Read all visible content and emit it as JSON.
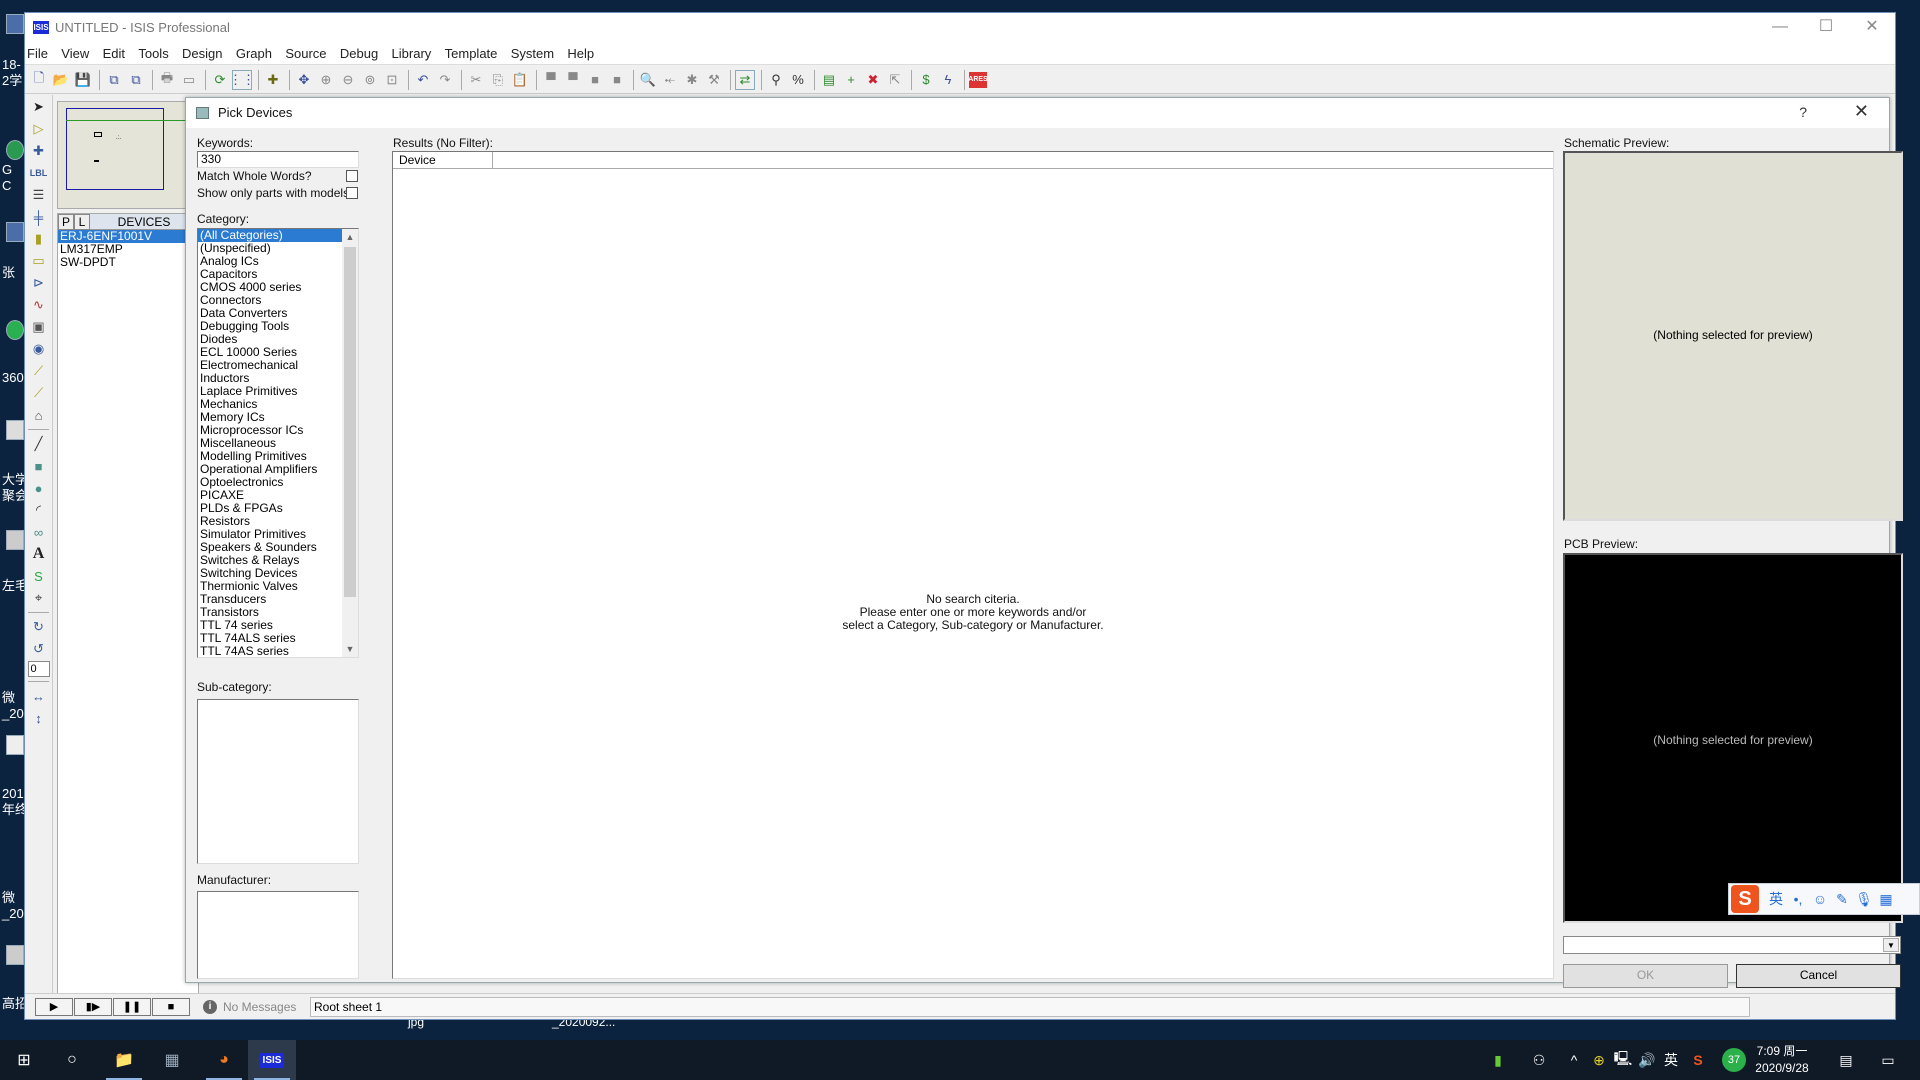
{
  "desktop": {
    "side_labels": [
      "18-",
      "2学",
      "G",
      "C",
      "张",
      "360",
      "大学",
      "聚会",
      "左毛",
      "微",
      "_20",
      "201",
      "年终",
      "微",
      "_20",
      "高招"
    ],
    "taskbar_labels_behind": [
      "_2020092...",
      "jpg"
    ]
  },
  "window": {
    "title": "UNTITLED - ISIS Professional",
    "app_icon": "ISIS",
    "controls": {
      "minimize": "—",
      "maximize": "☐",
      "close": "✕"
    }
  },
  "menu": [
    "File",
    "View",
    "Edit",
    "Tools",
    "Design",
    "Graph",
    "Source",
    "Debug",
    "Library",
    "Template",
    "System",
    "Help"
  ],
  "toolbar": {
    "groups": [
      [
        "new-file-icon",
        "open-file-icon",
        "save-icon"
      ],
      [
        "import-section-icon",
        "export-section-icon"
      ],
      [
        "print-icon",
        "print-area-icon"
      ],
      [
        "refresh-icon",
        "grid-icon"
      ],
      [
        "origin-icon"
      ],
      [
        "pan-icon",
        "zoom-in-icon",
        "zoom-out-icon",
        "zoom-all-icon",
        "zoom-area-icon"
      ],
      [
        "undo-icon",
        "redo-icon"
      ],
      [
        "cut-icon",
        "copy-icon",
        "paste-icon"
      ],
      [
        "block-copy-icon",
        "block-move-icon",
        "block-rotate-icon",
        "block-delete-icon"
      ],
      [
        "pick-device-icon",
        "make-device-icon",
        "packaging-tool-icon",
        "decompose-icon"
      ],
      [
        "wire-autorouter-icon"
      ],
      [
        "search-tag-icon",
        "property-assignment-icon"
      ],
      [
        "design-explorer-icon",
        "new-sheet-icon",
        "remove-sheet-icon",
        "goto-sheet-icon"
      ],
      [
        "bill-of-materials-icon",
        "electrical-rule-check-icon"
      ],
      [
        "ares-icon"
      ]
    ],
    "ares_label": "ARES"
  },
  "left_tools": [
    "selection-mode-icon",
    "component-mode-icon",
    "junction-icon",
    "wire-label-icon",
    "text-script-icon",
    "bus-icon",
    "subcircuit-icon",
    "terminals-icon",
    "device-pins-icon",
    "graph-icon",
    "tape-recorder-icon",
    "generator-icon",
    "voltage-probe-icon",
    "current-probe-icon",
    "virtual-instrument-icon",
    "line-icon",
    "box-icon",
    "circle-icon",
    "arc-icon",
    "closed-path-icon",
    "text-icon",
    "symbol-icon",
    "marker-icon",
    "rotate-clockwise-icon",
    "rotate-anticlockwise-icon",
    "mirror-x-icon",
    "mirror-y-icon"
  ],
  "rotation_value": "0",
  "devices_panel": {
    "tab_p": "P",
    "tab_l": "L",
    "title": "DEVICES",
    "items": [
      "ERJ-6ENF1001V",
      "LM317EMP",
      "SW-DPDT"
    ],
    "selected_index": 0
  },
  "dialog": {
    "title": "Pick Devices",
    "help": "?",
    "close": "✕",
    "keywords_label": "Keywords:",
    "keywords_value": "330",
    "match_whole_words_label": "Match Whole Words?",
    "match_whole_words_checked": false,
    "show_models_label": "Show only parts with models?",
    "show_models_checked": false,
    "category_label": "Category:",
    "categories": [
      "(All Categories)",
      "(Unspecified)",
      "Analog ICs",
      "Capacitors",
      "CMOS 4000 series",
      "Connectors",
      "Data Converters",
      "Debugging Tools",
      "Diodes",
      "ECL 10000 Series",
      "Electromechanical",
      "Inductors",
      "Laplace Primitives",
      "Mechanics",
      "Memory ICs",
      "Microprocessor ICs",
      "Miscellaneous",
      "Modelling Primitives",
      "Operational Amplifiers",
      "Optoelectronics",
      "PICAXE",
      "PLDs & FPGAs",
      "Resistors",
      "Simulator Primitives",
      "Speakers & Sounders",
      "Switches & Relays",
      "Switching Devices",
      "Thermionic Valves",
      "Transducers",
      "Transistors",
      "TTL 74 series",
      "TTL 74ALS series",
      "TTL 74AS series"
    ],
    "selected_category_index": 0,
    "subcategory_label": "Sub-category:",
    "manufacturer_label": "Manufacturer:",
    "results_label": "Results (No Filter):",
    "results_columns": [
      "Device",
      ""
    ],
    "no_search_lines": [
      "No search citeria.",
      "Please enter one or more keywords and/or",
      "select a Category, Sub-category or Manufacturer."
    ],
    "schematic_preview_label": "Schematic Preview:",
    "schematic_preview_msg": "(Nothing selected for preview)",
    "pcb_preview_label": "PCB Preview:",
    "pcb_preview_msg": "(Nothing selected for preview)",
    "package_combo_value": "",
    "ok_label": "OK",
    "ok_enabled": false,
    "cancel_label": "Cancel",
    "colors": {
      "selection": "#2b7bd2",
      "schematic_bg": "#e0e0d5",
      "pcb_bg": "#000000"
    }
  },
  "statusbar": {
    "sim_buttons": [
      "play",
      "step",
      "pause",
      "stop"
    ],
    "message": "No Messages",
    "sheet": "Root sheet 1"
  },
  "ime": {
    "logo": "S",
    "lang": "英",
    "punct": "•,",
    "emoji": "☺",
    "pen": "✎",
    "mic": "🎙",
    "grid": "▦"
  },
  "taskbar": {
    "apps": [
      "start",
      "cortana",
      "file-explorer",
      "calculator",
      "firefox",
      "isis"
    ],
    "isis_label": "ISIS",
    "tray": {
      "lang": "英",
      "badge": "37",
      "time": "7:09 周一",
      "date": "2020/9/28"
    }
  }
}
